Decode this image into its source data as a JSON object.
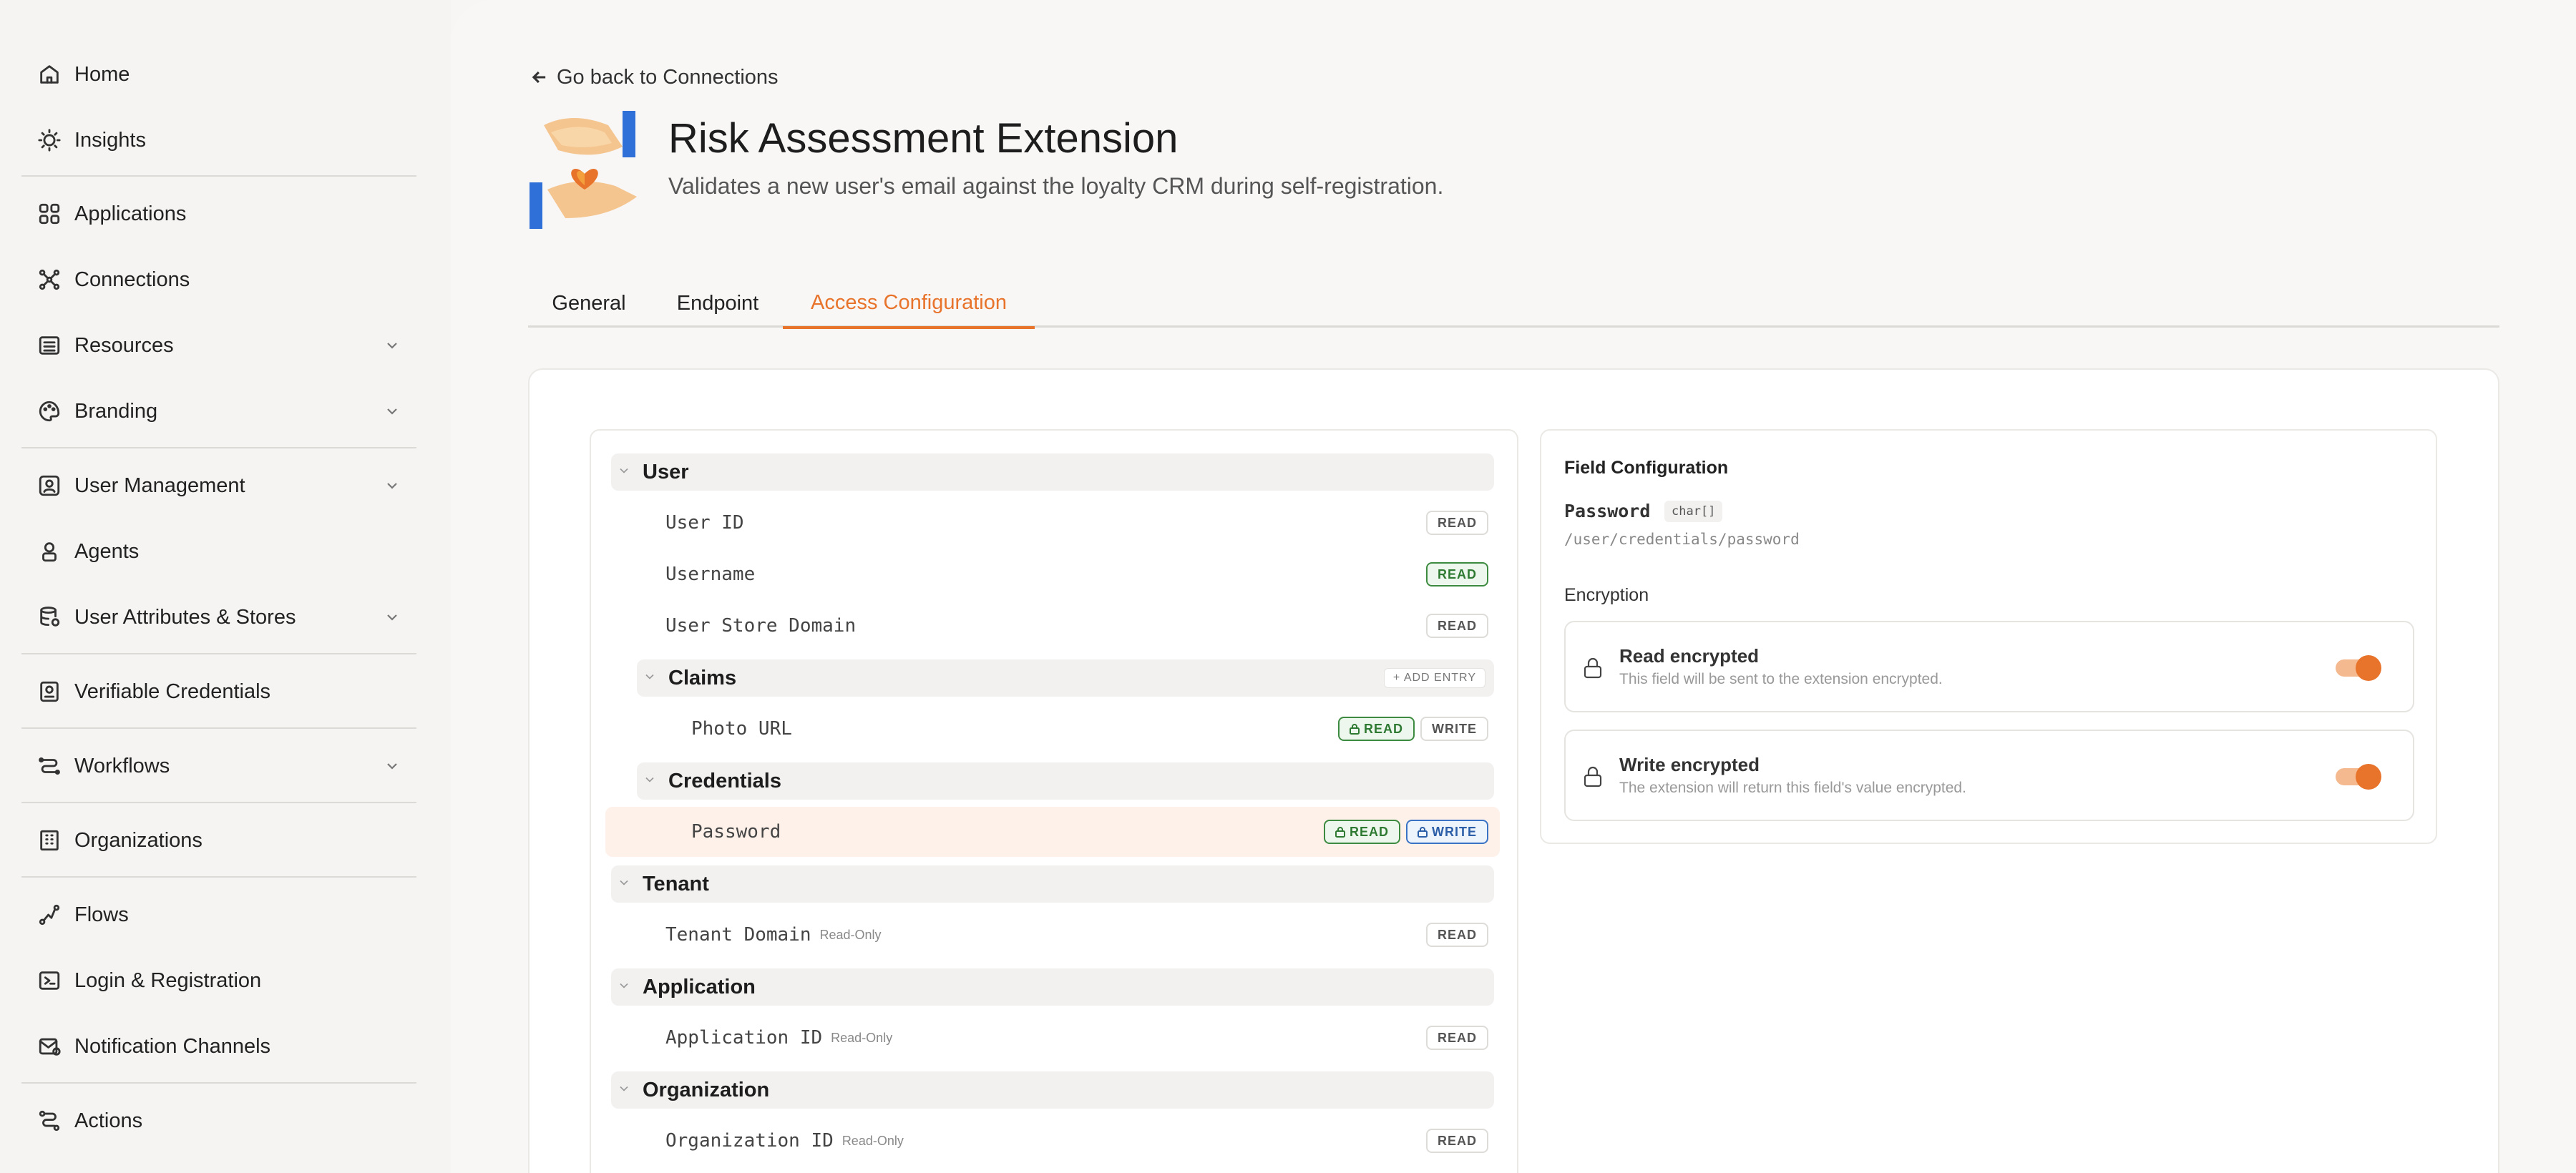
{
  "sidebar": {
    "items": [
      {
        "label": "Home",
        "icon": "home-icon"
      },
      {
        "label": "Insights",
        "icon": "lightbulb-icon"
      },
      {
        "label": "Applications",
        "icon": "apps-grid-icon"
      },
      {
        "label": "Connections",
        "icon": "connections-icon"
      },
      {
        "label": "Resources",
        "icon": "resources-icon",
        "expandable": true
      },
      {
        "label": "Branding",
        "icon": "palette-icon",
        "expandable": true
      },
      {
        "label": "User Management",
        "icon": "user-card-icon",
        "expandable": true
      },
      {
        "label": "Agents",
        "icon": "agent-icon"
      },
      {
        "label": "User Attributes & Stores",
        "icon": "database-icon",
        "expandable": true
      },
      {
        "label": "Verifiable Credentials",
        "icon": "credential-icon"
      },
      {
        "label": "Workflows",
        "icon": "workflow-icon",
        "expandable": true
      },
      {
        "label": "Organizations",
        "icon": "building-icon"
      },
      {
        "label": "Flows",
        "icon": "flow-icon"
      },
      {
        "label": "Login & Registration",
        "icon": "login-icon"
      },
      {
        "label": "Notification Channels",
        "icon": "notification-icon"
      },
      {
        "label": "Actions",
        "icon": "actions-icon"
      }
    ]
  },
  "header": {
    "back_label": "Go back to Connections",
    "title": "Risk Assessment Extension",
    "description": "Validates a new user's email against the loyalty CRM during self-registration."
  },
  "tabs": [
    {
      "label": "General"
    },
    {
      "label": "Endpoint"
    },
    {
      "label": "Access Configuration",
      "active": true
    }
  ],
  "tree": {
    "groups": {
      "user": "User",
      "claims": "Claims",
      "credentials": "Credentials",
      "tenant": "Tenant",
      "application": "Application",
      "organization": "Organization"
    },
    "add_entry": "+ ADD ENTRY",
    "fields": {
      "user_id": "User ID",
      "username": "Username",
      "user_store_domain": "User Store Domain",
      "photo_url": "Photo URL",
      "password": "Password",
      "tenant_domain": "Tenant Domain",
      "application_id": "Application ID",
      "organization_id": "Organization ID"
    },
    "read_only": "Read-Only",
    "badge_read": "READ",
    "badge_write": "WRITE"
  },
  "field_config": {
    "title": "Field Configuration",
    "name": "Password",
    "type": "char[]",
    "path": "/user/credentials/password",
    "encryption_label": "Encryption",
    "read": {
      "title": "Read encrypted",
      "desc": "This field will be sent to the extension encrypted.",
      "enabled": true
    },
    "write": {
      "title": "Write encrypted",
      "desc": "The extension will return this field's value encrypted.",
      "enabled": true
    }
  },
  "colors": {
    "accent": "#e8732a",
    "read_green": "#2f7a32",
    "write_blue": "#2c5fa8"
  }
}
